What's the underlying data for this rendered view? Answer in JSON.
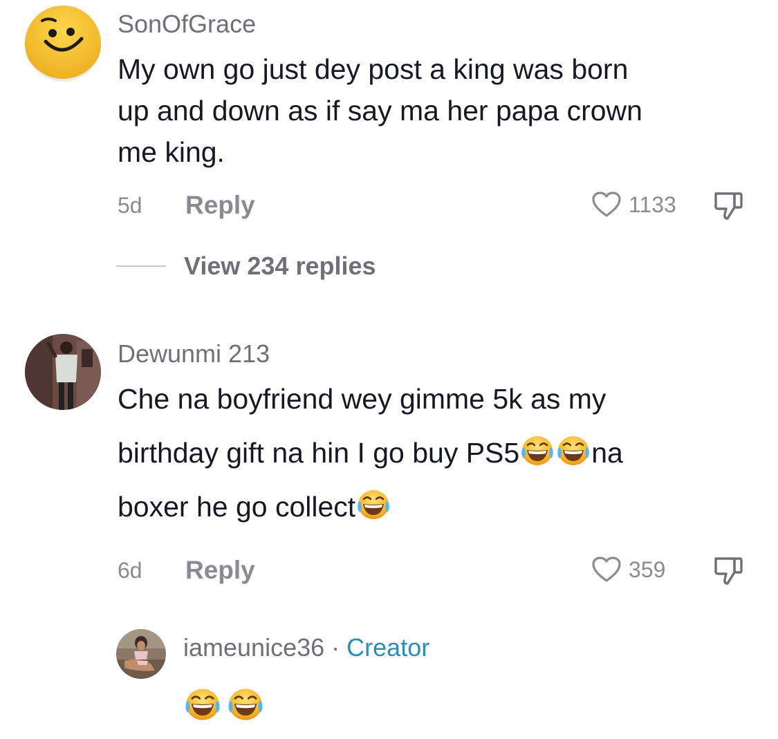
{
  "comments": [
    {
      "username": "SonOfGrace",
      "lines": [
        "My own go just dey post a king was born",
        "up and down as if say ma her papa crown",
        "me king."
      ],
      "time": "5d",
      "reply_label": "Reply",
      "likes": "1133",
      "view_replies": "View 234 replies",
      "avatar": "smiley-face-avatar"
    },
    {
      "username": "Dewunmi 213",
      "line1": "Che na boyfriend wey gimme 5k as my",
      "line2_text": "birthday gift na hin I go buy PS5",
      "line2_tail": "na",
      "line3_text": "boxer he go collect",
      "time": "6d",
      "reply_label": "Reply",
      "likes": "359",
      "avatar": "person-photo-avatar"
    }
  ],
  "reply": {
    "username": "iameunice36",
    "separator": "·",
    "badge": "Creator",
    "avatar": "person-photo-avatar",
    "content": "laughing-emoji laughing-emoji"
  },
  "icons": {
    "like": "heart-icon",
    "dislike": "thumbs-down-icon",
    "emoji": "face-with-tears-of-joy-emoji"
  },
  "colors": {
    "text_primary": "#161823",
    "text_secondary": "#6f7077",
    "text_muted": "#8a8b91",
    "creator": "#2a8fb7",
    "smiley_yellow": "#f6c12e"
  }
}
